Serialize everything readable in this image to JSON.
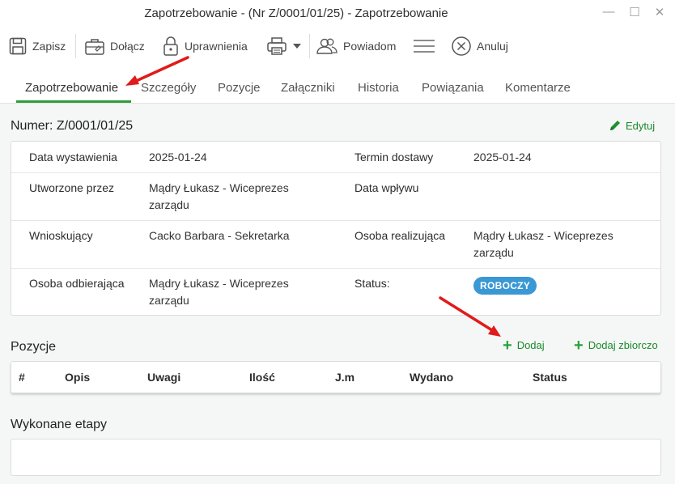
{
  "window": {
    "title": "Zapotrzebowanie - (Nr Z/0001/01/25) - Zapotrzebowanie",
    "minimize": "—",
    "maximize": "☐",
    "close": "✕"
  },
  "toolbar": {
    "save_label": "Zapisz",
    "attach_label": "Dołącz",
    "permissions_label": "Uprawnienia",
    "notify_label": "Powiadom",
    "cancel_label": "Anuluj"
  },
  "tabs": [
    {
      "label": "Zapotrzebowanie",
      "active": true
    },
    {
      "label": "Szczegóły"
    },
    {
      "label": "Pozycje"
    },
    {
      "label": "Załączniki"
    },
    {
      "label": "Historia"
    },
    {
      "label": "Powiązania"
    },
    {
      "label": "Komentarze"
    }
  ],
  "header": {
    "numer": "Numer: Z/0001/01/25",
    "edit_label": "Edytuj"
  },
  "info": {
    "data_wystawienia_label": "Data wystawienia",
    "data_wystawienia": "2025-01-24",
    "termin_dostawy_label": "Termin dostawy",
    "termin_dostawy": "2025-01-24",
    "utworzone_przez_label": "Utworzone przez",
    "utworzone_przez_1": "Mądry Łukasz - Wiceprezes",
    "utworzone_przez_2": "zarządu",
    "data_wplywu_label": "Data wpływu",
    "wnioskujacy_label": "Wnioskujący",
    "wnioskujacy": "Cacko Barbara - Sekretarka",
    "osoba_realizujaca_label": "Osoba realizująca",
    "osoba_realizujaca_1": "Mądry Łukasz - Wiceprezes",
    "osoba_realizujaca_2": "zarządu",
    "osoba_odbierajaca_label": "Osoba odbierająca",
    "osoba_odbierajaca_1": "Mądry Łukasz - Wiceprezes",
    "osoba_odbierajaca_2": "zarządu",
    "status_label": "Status:",
    "status": "ROBOCZY"
  },
  "pozycje": {
    "title": "Pozycje",
    "add_label": "Dodaj",
    "add_bulk_label": "Dodaj zbiorczo",
    "columns": [
      "#",
      "Opis",
      "Uwagi",
      "Ilość",
      "J.m",
      "Wydano",
      "Status"
    ]
  },
  "etapy": {
    "title": "Wykonane etapy"
  },
  "colors": {
    "accent": "#2f9e3b",
    "status_badge": "#3a98d4",
    "annotation_arrow": "#e01b1b"
  }
}
